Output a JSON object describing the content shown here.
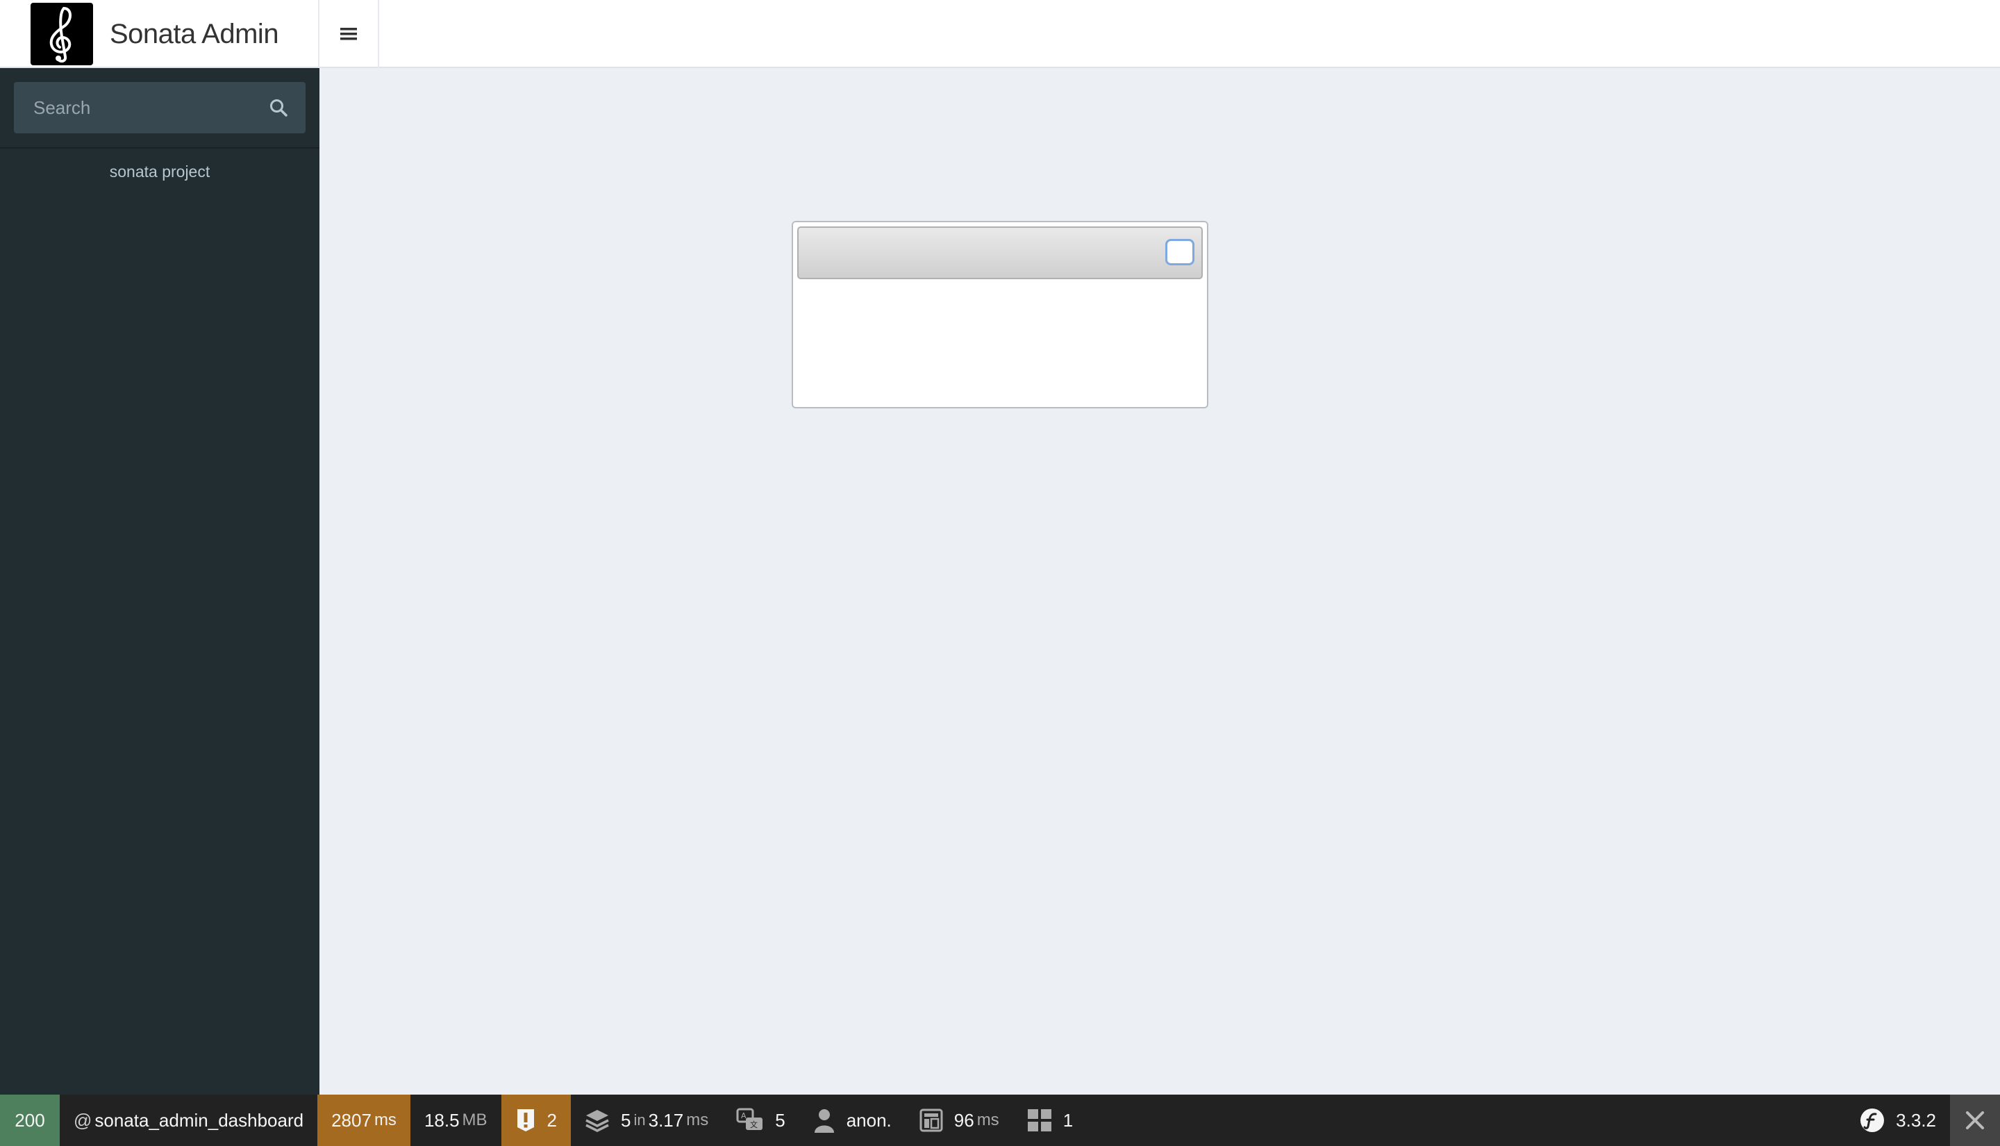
{
  "header": {
    "app_title": "Sonata Admin",
    "logo_icon": "treble-clef-icon",
    "menu_icon": "hamburger-icon"
  },
  "sidebar": {
    "search": {
      "placeholder": "Search",
      "value": ""
    },
    "footer_link": "sonata project"
  },
  "dialog": {
    "title": "",
    "close_icon": "close-icon"
  },
  "debug_toolbar": {
    "status_code": "200",
    "route_prefix": "@",
    "route": "sonata_admin_dashboard",
    "request_time": "2807",
    "request_time_unit": "ms",
    "memory": "18.5",
    "memory_unit": "MB",
    "logs_count": "2",
    "db_queries": "5",
    "db_in": "in",
    "db_time": "3.17",
    "db_time_unit": "ms",
    "translations": "5",
    "user": "anon.",
    "twig_time": "96",
    "twig_time_unit": "ms",
    "forms_count": "1",
    "symfony_version": "3.3.2",
    "colors": {
      "status_ok": "#4f805d",
      "warning": "#a46a1f",
      "toolbar_bg": "#222222"
    }
  }
}
